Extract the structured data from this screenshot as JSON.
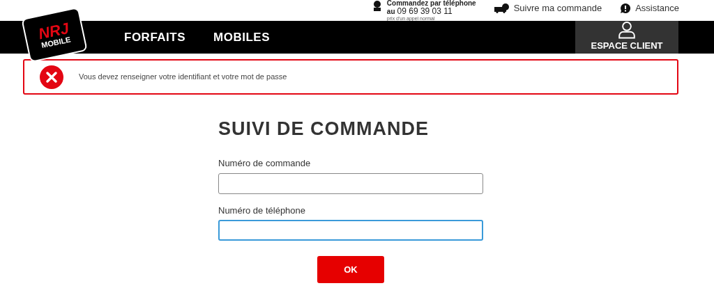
{
  "top_bar": {
    "phone_label": "Commandez par téléphone",
    "phone_prefix": "au",
    "phone_number": "09 69 39 03 11",
    "phone_note": "prix d'un appel normal",
    "links": [
      {
        "kind": "track",
        "label": "Suivre ma commande"
      },
      {
        "kind": "help",
        "label": "Assistance"
      }
    ]
  },
  "logo": {
    "brand": "NRJ",
    "sub": "MOBILE"
  },
  "nav": {
    "items": [
      {
        "label": "FORFAITS"
      },
      {
        "label": "MOBILES"
      }
    ],
    "account": {
      "label": "ESPACE CLIENT"
    }
  },
  "alert": {
    "message": "Vous devez renseigner votre identifiant et votre mot de passe"
  },
  "form": {
    "title": "SUIVI DE COMMANDE",
    "fields": [
      {
        "label": "Numéro de commande",
        "focused": false
      },
      {
        "label": "Numéro de téléphone",
        "focused": true
      }
    ],
    "submit": "OK"
  }
}
